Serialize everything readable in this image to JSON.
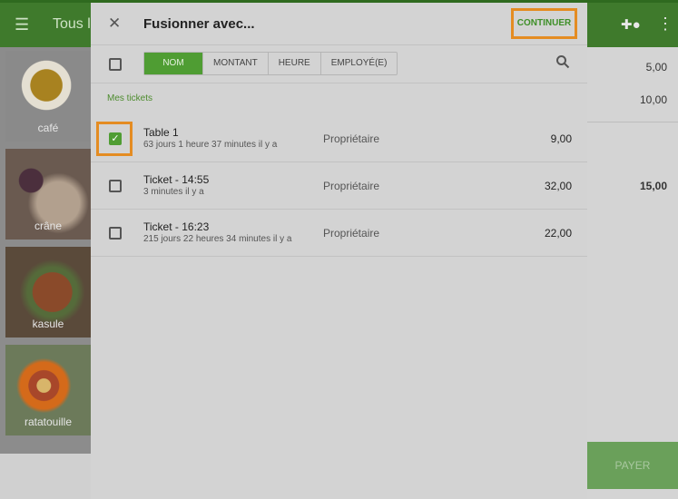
{
  "background": {
    "topbar": {
      "title": "Tous les"
    },
    "tiles": [
      {
        "label": "café"
      },
      {
        "label": "crâne"
      },
      {
        "label": "kasule"
      },
      {
        "label": "ratatouille"
      }
    ],
    "ticket_amounts": [
      "5,00",
      "10,00",
      "15,00"
    ],
    "pay_label": "PAYER"
  },
  "dialog": {
    "title": "Fusionner avec...",
    "continue_label": "CONTINUER",
    "tabs": [
      "NOM",
      "MONTANT",
      "HEURE",
      "EMPLOYÉ(E)"
    ],
    "active_tab": "NOM",
    "section_title": "Mes tickets",
    "tickets": [
      {
        "name": "Table 1",
        "time": "63 jours 1 heure 37 minutes  il y a",
        "employee": "Propriétaire",
        "amount": "9,00",
        "checked": true
      },
      {
        "name": "Ticket - 14:55",
        "time": "3 minutes  il y a",
        "employee": "Propriétaire",
        "amount": "32,00",
        "checked": false
      },
      {
        "name": "Ticket - 16:23",
        "time": "215 jours 22 heures 34 minutes  il y a",
        "employee": "Propriétaire",
        "amount": "22,00",
        "checked": false
      }
    ]
  },
  "colors": {
    "accent": "#4f9d33",
    "highlight": "#e48c22"
  }
}
